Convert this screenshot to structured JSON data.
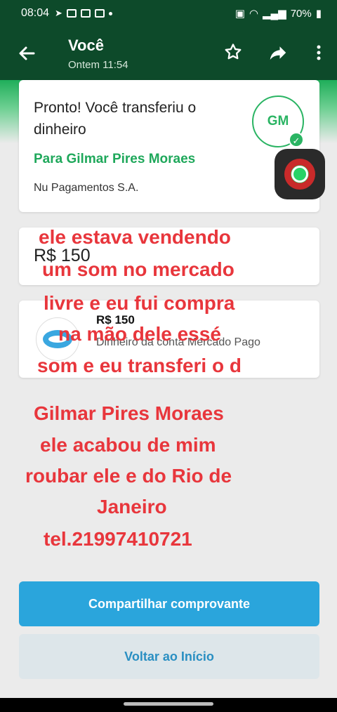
{
  "status_bar": {
    "time": "08:04",
    "battery": "70%"
  },
  "app_bar": {
    "back_icon": "arrow-left-icon",
    "title": "Você",
    "subtitle": "Ontem 11:54",
    "star_icon": "star-icon",
    "share_icon": "share-icon",
    "more_icon": "more-vertical-icon"
  },
  "confirmation": {
    "headline": "Pronto! Você transferiu o dinheiro",
    "recipient": "Para Gilmar Pires Moraes",
    "bank": "Nu Pagamentos S.A.",
    "avatar_initials": "GM",
    "check_icon": "check-icon"
  },
  "amount_card": {
    "amount": "R$ 150"
  },
  "payment_card": {
    "amount": "R$ 150",
    "source": "Dinheiro da conta Mercado Pago",
    "logo_icon": "mercado-pago-logo-icon"
  },
  "overlay_text": {
    "line1": "ele estava  vendendo",
    "line2": "um som no mercado",
    "line3": "livre e eu fui compra",
    "line4": "na mão dele essé",
    "line5": "som e eu transferi o d",
    "line6": "Gilmar Pires Moraes",
    "line7": "ele acabou de mim",
    "line8": "roubar ele e do Rio de",
    "line9": "Janeiro",
    "line10": "tel.21997410721"
  },
  "actions": {
    "share_receipt": "Compartilhar comprovante",
    "back_home": "Voltar ao Início"
  },
  "colors": {
    "header": "#0d4a2a",
    "accent_green": "#1fa85b",
    "primary_button": "#2aa5dc",
    "overlay_red": "#e8363c"
  }
}
